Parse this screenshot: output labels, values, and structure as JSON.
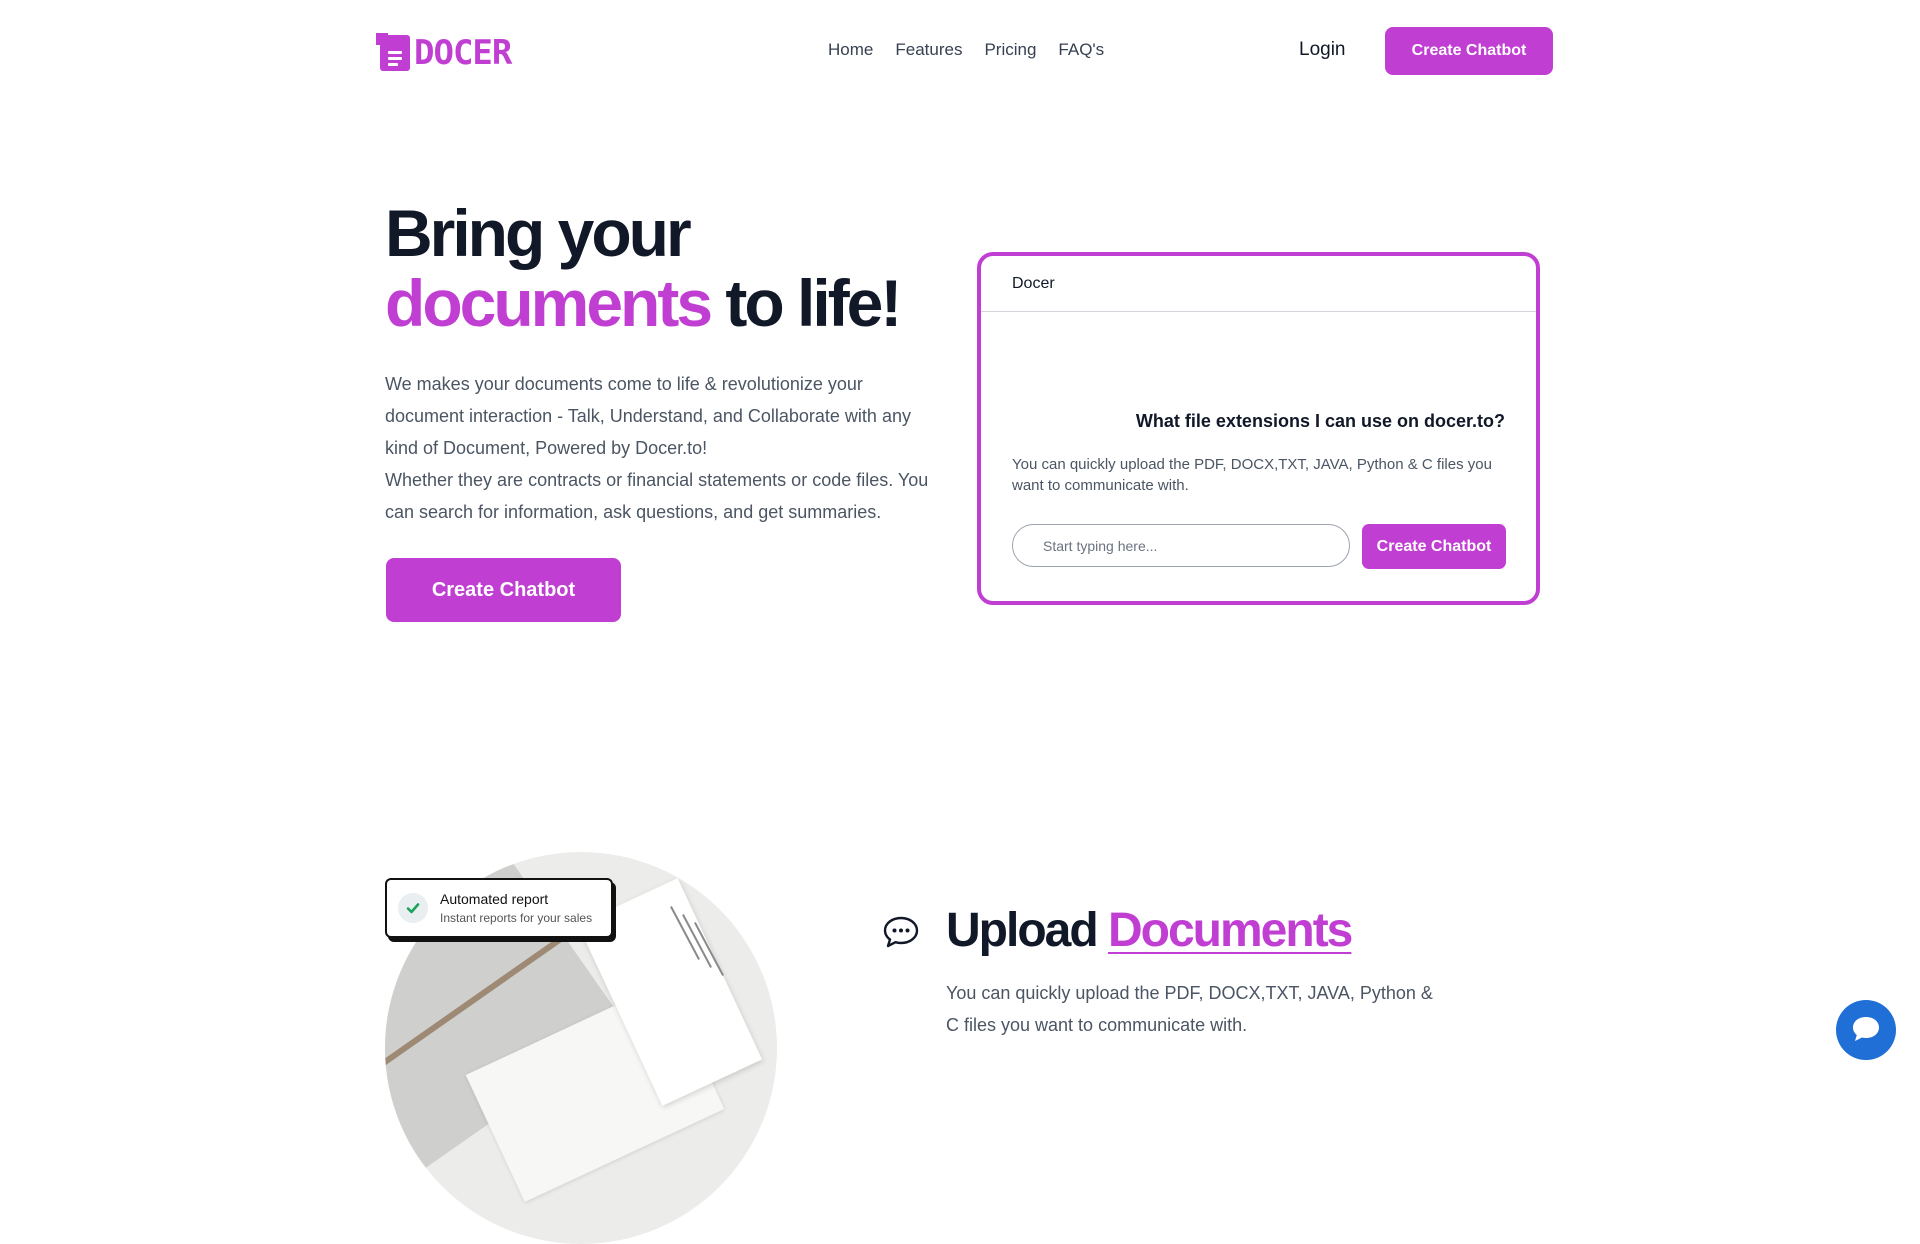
{
  "brand": {
    "name": "DOCER",
    "color": "#c13ed3"
  },
  "nav": {
    "items": [
      "Home",
      "Features",
      "Pricing",
      "FAQ's"
    ]
  },
  "header": {
    "login": "Login",
    "cta": "Create Chatbot"
  },
  "hero": {
    "title_line1": "Bring your",
    "title_accent": "documents",
    "title_rest": " to life!",
    "description": "We makes your documents come to life & revolutionize your document interaction - Talk, Understand, and Collaborate with any kind of Document, Powered by Docer.to!",
    "description2": "Whether they are contracts or financial statements or code files. You can search for information, ask questions, and get summaries.",
    "cta": "Create Chatbot"
  },
  "chat": {
    "title": "Docer",
    "question": "What file extensions I can use on docer.to?",
    "answer": "You can quickly upload the PDF, DOCX,TXT, JAVA, Python & C files you want to communicate with.",
    "input_placeholder": "Start typing here...",
    "button": "Create Chatbot"
  },
  "badge": {
    "title": "Automated report",
    "subtitle": "Instant reports for your sales"
  },
  "upload": {
    "title_plain": "Upload ",
    "title_accent": "Documents",
    "description": "You can quickly upload the PDF, DOCX,TXT, JAVA, Python & C files you want to communicate with."
  },
  "icons": {
    "upload": "chat-bubble-icon",
    "fab": "chat-icon",
    "badge": "check-icon"
  }
}
